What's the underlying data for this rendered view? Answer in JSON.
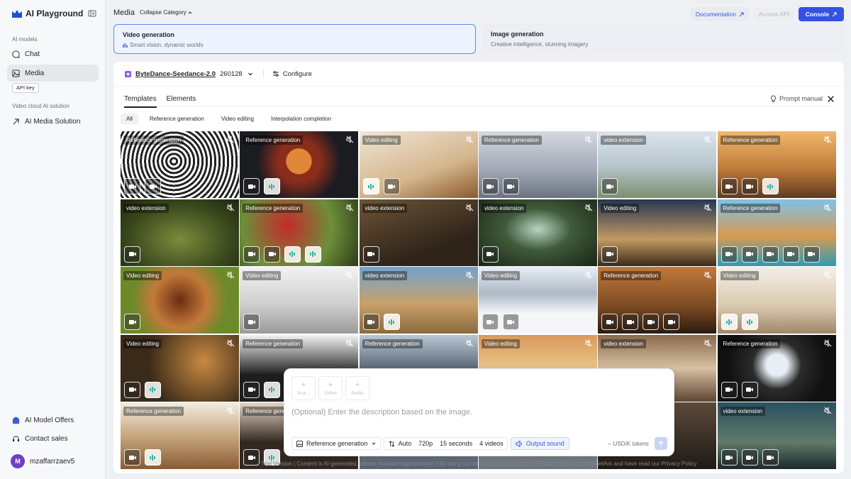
{
  "sidebar": {
    "brand": "AI Playground",
    "section_models": "AI models",
    "items": [
      {
        "label": "Chat"
      },
      {
        "label": "Media"
      }
    ],
    "api_key": "API key",
    "section_solution": "Video cloud AI solution",
    "solution_item": "AI Media Solution",
    "offers": "AI Model Offers",
    "contact": "Contact sales",
    "user": {
      "initial": "M",
      "name": "mzaffarrzaev5"
    }
  },
  "header": {
    "title": "Media",
    "collapse": "Collapse Category",
    "documentation": "Documentation",
    "access_api": "Access API",
    "console": "Console"
  },
  "categories": [
    {
      "title": "Video generation",
      "subtitle": "Smart vision, dynamic worlds",
      "selected": true
    },
    {
      "title": "Image generation",
      "subtitle": "Creative intelligence, stunning imagery",
      "selected": false
    }
  ],
  "model": {
    "name": "ByteDance-Seedance-2.0",
    "version": "260128",
    "configure": "Configure"
  },
  "tabs": [
    {
      "label": "Templates"
    },
    {
      "label": "Elements"
    }
  ],
  "prompt_manual": "Prompt manual",
  "filters": [
    {
      "label": "All"
    },
    {
      "label": "Reference generation"
    },
    {
      "label": "Video editing"
    },
    {
      "label": "Interpolation completion"
    }
  ],
  "tiles": [
    {
      "tag": "Reference generation"
    },
    {
      "tag": "Reference generation"
    },
    {
      "tag": "Video editing"
    },
    {
      "tag": "Reference generation"
    },
    {
      "tag": "video extension"
    },
    {
      "tag": "Reference generation"
    },
    {
      "tag": "video extension"
    },
    {
      "tag": "Reference generation"
    },
    {
      "tag": "video extension"
    },
    {
      "tag": "video extension"
    },
    {
      "tag": "Video editing"
    },
    {
      "tag": "Reference generation"
    },
    {
      "tag": "Video editing"
    },
    {
      "tag": "Video editing"
    },
    {
      "tag": "video extension"
    },
    {
      "tag": "Video editing"
    },
    {
      "tag": "Reference generation"
    },
    {
      "tag": "Video editing"
    },
    {
      "tag": "Video editing"
    },
    {
      "tag": "Reference generation"
    },
    {
      "tag": "Reference generation"
    },
    {
      "tag": "Video editing"
    },
    {
      "tag": "video extension"
    },
    {
      "tag": "Reference generation"
    },
    {
      "tag": "Reference generation"
    },
    {
      "tag": "Reference generation"
    },
    {
      "tag": ""
    },
    {
      "tag": ""
    },
    {
      "tag": ""
    },
    {
      "tag": "video extension"
    }
  ],
  "composer": {
    "upload_image": "Ima...",
    "upload_video": "Video",
    "upload_audio": "Audio",
    "placeholder": "(Optional) Enter the description based on the image.",
    "mode": "Reference generation",
    "ratio": "Auto",
    "resolution": "720p",
    "duration": "15 seconds",
    "count": "4 videos",
    "sound": "Output sound",
    "price": "-- USD/K tokens"
  },
  "footer": "Trial Version | Content is AI-generated, please evaluate appropriately. | By using our service, you agree to the Terms of Service for ModelArk and have read our Privacy Policy",
  "colors": {
    "accent": "#3451e6",
    "selected_border": "#5b8def",
    "avatar": "#6f3fc1"
  }
}
